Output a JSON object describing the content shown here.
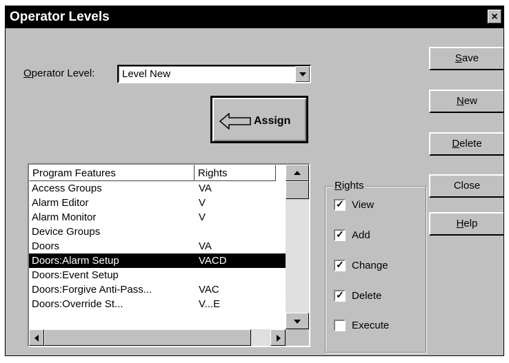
{
  "window": {
    "title": "Operator Levels",
    "close_glyph": "×"
  },
  "operator_level": {
    "label_first": "O",
    "label_rest": "perator Level:",
    "value": "Level New"
  },
  "assign_button": {
    "label": "Assign",
    "icon": "left-arrow-icon"
  },
  "buttons": {
    "save": {
      "ul": "S",
      "rest": "ave"
    },
    "new": {
      "ul": "N",
      "rest": "ew"
    },
    "delete": {
      "ul": "D",
      "rest": "elete"
    },
    "close": {
      "ul": "",
      "rest": "Close"
    },
    "help": {
      "ul": "H",
      "rest": "elp"
    }
  },
  "list": {
    "columns": [
      "Program Features",
      "Rights"
    ],
    "rows": [
      {
        "feature": "Access Groups",
        "rights": "VA",
        "selected": false
      },
      {
        "feature": "Alarm Editor",
        "rights": "V",
        "selected": false
      },
      {
        "feature": "Alarm Monitor",
        "rights": "V",
        "selected": false
      },
      {
        "feature": "Device Groups",
        "rights": "",
        "selected": false
      },
      {
        "feature": "Doors",
        "rights": "VA",
        "selected": false
      },
      {
        "feature": "Doors:Alarm Setup",
        "rights": "VACD",
        "selected": true
      },
      {
        "feature": "Doors:Event Setup",
        "rights": "",
        "selected": false
      },
      {
        "feature": "Doors:Forgive Anti-Pass...",
        "rights": "VAC",
        "selected": false
      },
      {
        "feature": "Doors:Override St...",
        "rights": "V...E",
        "selected": false
      }
    ]
  },
  "rights_group": {
    "title_ul": "R",
    "title_rest": "ights",
    "checkboxes": [
      {
        "label": "View",
        "checked": true
      },
      {
        "label": "Add",
        "checked": true
      },
      {
        "label": "Change",
        "checked": true
      },
      {
        "label": "Delete",
        "checked": true
      },
      {
        "label": "Execute",
        "checked": false
      }
    ]
  }
}
